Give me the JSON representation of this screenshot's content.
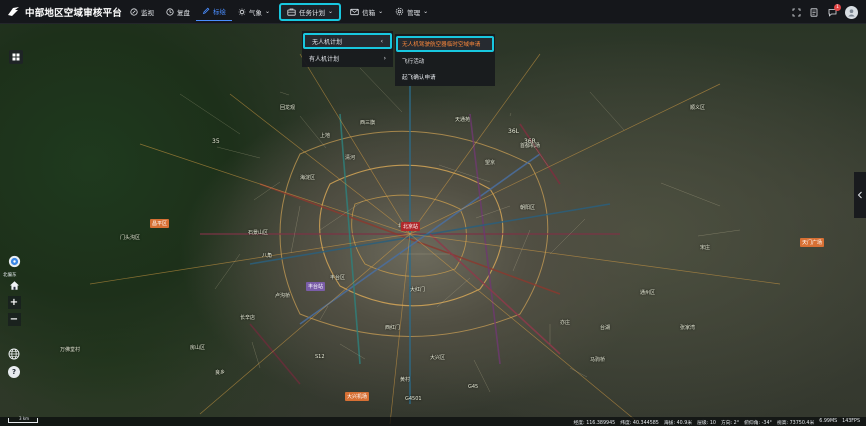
{
  "app": {
    "title": "中部地区空域审核平台"
  },
  "nav": {
    "items": [
      {
        "label": "监视",
        "icon": "monitor-icon"
      },
      {
        "label": "复盘",
        "icon": "clock-icon"
      },
      {
        "label": "标绘",
        "icon": "pen-icon"
      },
      {
        "label": "气象",
        "icon": "sun-icon",
        "chevron": "⌄"
      },
      {
        "label": "任务计划",
        "icon": "briefcase-icon",
        "chevron": "⌄"
      },
      {
        "label": "信箱",
        "icon": "mail-icon",
        "chevron": "⌄"
      },
      {
        "label": "管理",
        "icon": "gear-icon",
        "chevron": "⌄"
      }
    ],
    "active_color": "#4a8dff",
    "highlight_color": "#18c7df"
  },
  "top_right": {
    "notification_count": "1"
  },
  "task_menu": {
    "items": [
      {
        "label": "无人机计划",
        "arrow": "‹"
      },
      {
        "label": "有人机计划",
        "arrow": "›"
      }
    ]
  },
  "uav_submenu": {
    "items": [
      {
        "label": "无人机驾驶航空器临时空域申请"
      },
      {
        "label": "飞行活动"
      },
      {
        "label": "起飞确认申请"
      }
    ],
    "selected_color": "#ff8a3c"
  },
  "map": {
    "labels": [
      "北京",
      "海淀区",
      "朝阳区",
      "丰台区",
      "石景山区",
      "门头沟区",
      "大兴区",
      "房山区",
      "顺义区",
      "通州区",
      "西三旗",
      "回龙观",
      "清河",
      "望京",
      "亦庄",
      "大红门",
      "卢沟桥",
      "良乡",
      "长辛店",
      "西红门",
      "天通苑",
      "上地",
      "黄村",
      "八角",
      "首都机场",
      "万佛堂村",
      "马驹桥",
      "台湖",
      "宋庄",
      "张家湾"
    ],
    "road_numbers": [
      "35",
      "36R",
      "36L",
      "G4501",
      "G45",
      "S12"
    ],
    "tags": [
      "北京站",
      "昌平区",
      "丰台站",
      "大兴机场",
      "天门广场"
    ]
  },
  "controls": {
    "compass_label": "北偏东"
  },
  "status": {
    "scale": "3 km",
    "longitude": "经度: 116.389945",
    "latitude": "纬度: 40.344585",
    "altitude": "海拔: 40.9米",
    "level": "层级: 10",
    "heading": "方向: 2°",
    "pitch": "俯仰角: -34°",
    "view_height": "视高: 73750.4米",
    "fps_ms": "6.99MS",
    "fps": "143FPS"
  }
}
